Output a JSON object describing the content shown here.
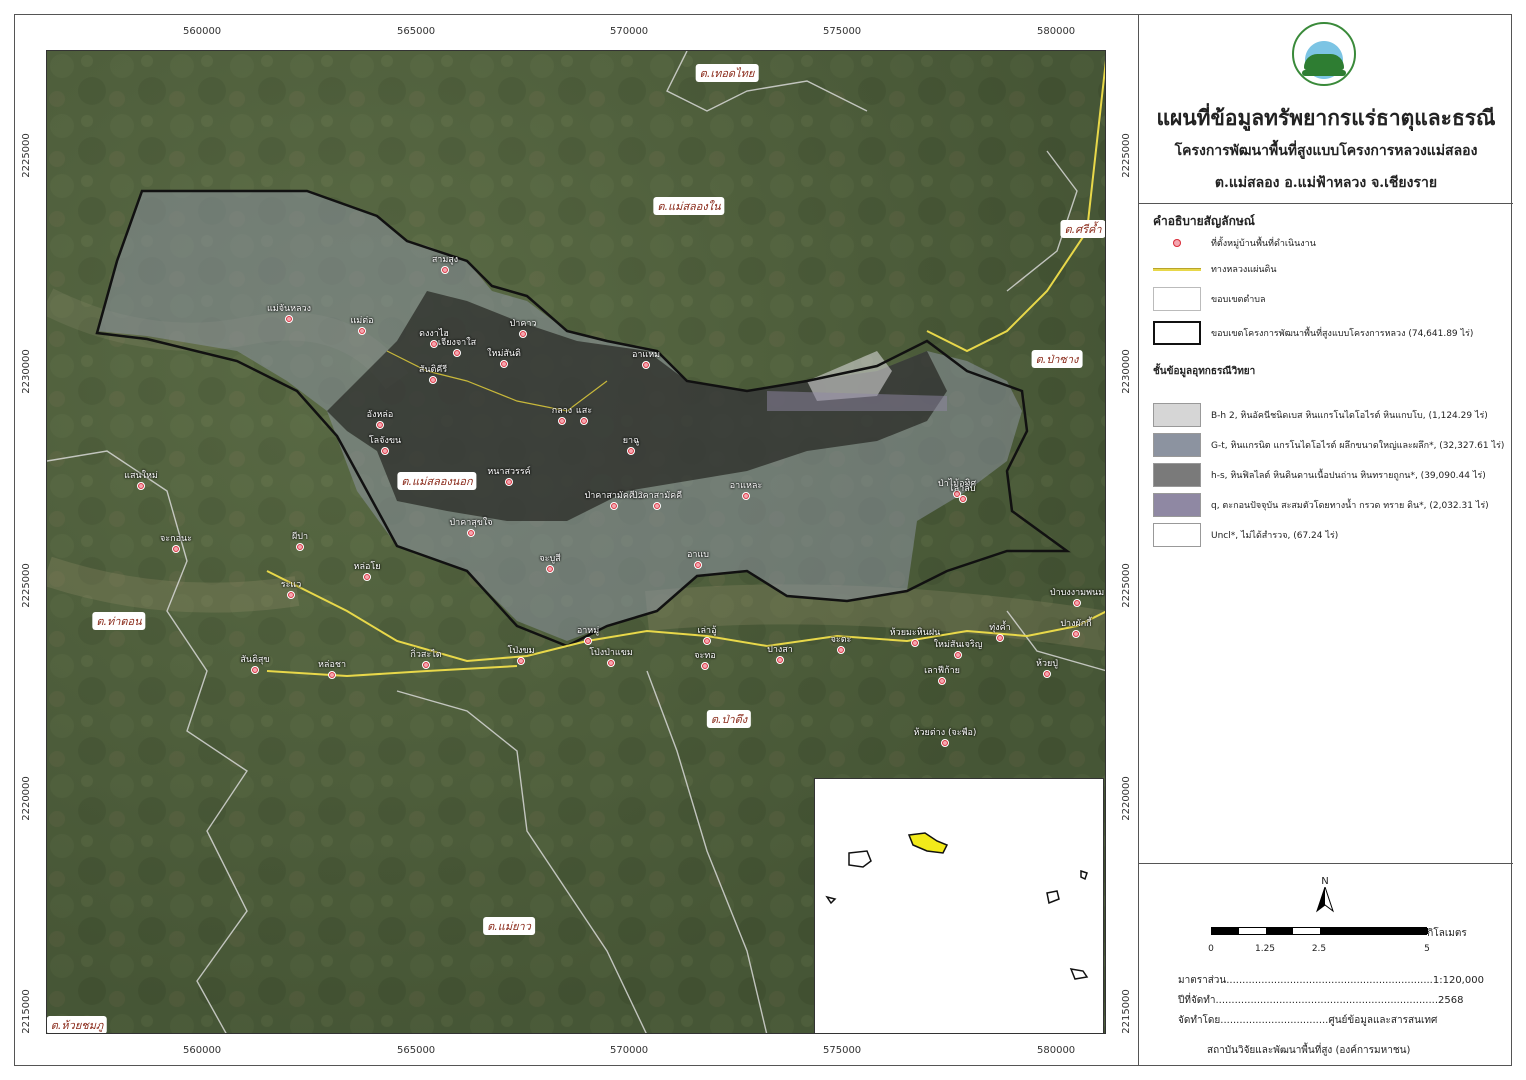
{
  "header": {
    "title": "แผนที่ข้อมูลทรัพยากรแร่ธาตุและธรณี",
    "subtitle": "โครงการพัฒนาพื้นที่สูงแบบโครงการหลวงแม่สลอง",
    "location": "ต.แม่สลอง อ.แม่ฟ้าหลวง จ.เชียงราย"
  },
  "coords": {
    "x_top": [
      "560000",
      "565000",
      "570000",
      "575000",
      "580000"
    ],
    "x_bottom": [
      "560000",
      "565000",
      "570000",
      "575000",
      "580000"
    ],
    "y_left": [
      "2225000",
      "2230000",
      "2225000",
      "2220000",
      "2215000"
    ],
    "y_right": [
      "2225000",
      "2230000",
      "2225000",
      "2220000",
      "2215000"
    ]
  },
  "legend": {
    "heading": "คำอธิบายสัญลักษณ์",
    "villages": "ที่ตั้งหมู่บ้านพื้นที่ดำเนินงาน",
    "highway": "ทางหลวงแผ่นดิน",
    "subdistrict": "ขอบเขตตำบล",
    "project": "ขอบเขตโครงการพัฒนาพื้นที่สูงแบบโครงการหลวง (74,641.89 ไร่)",
    "geo_heading": "ชั้นข้อมูลอุทกธรณีวิทยา",
    "geo": [
      {
        "label": "B-h 2, หินอัคนีชนิดเบส หินแกรโนไดโอไรต์ หินแกบโบ, (1,124.29 ไร่)",
        "color": "#d6d6d6"
      },
      {
        "label": "G-t, หินแกรนิต แกรโนไดโอไรต์ ผลึกขนาดใหญ่และผลึก*, (32,327.61 ไร่)",
        "color": "#8c93a0"
      },
      {
        "label": "h-s, หินฟิลไลต์ หินดินดานเนื้อปนถ่าน หินทรายถูกน*, (39,090.44 ไร่)",
        "color": "#7a7a7a"
      },
      {
        "label": "q, ตะกอนปัจจุบัน สะสมตัวโดยทางน้ำ กรวด ทราย ดิน*, (2,032.31 ไร่)",
        "color": "#8f88a3"
      },
      {
        "label": "Uncl*, ไม่ได้สำรวจ, (67.24 ไร่)",
        "color": "#ffffff"
      }
    ]
  },
  "scale": {
    "north": "N",
    "unit": "กิโลเมตร",
    "ticks": [
      "0",
      "1.25",
      "2.5",
      "5"
    ]
  },
  "info": {
    "scale_label": "มาตราส่วน.................................................................1:120,000",
    "year_label": "ปีที่จัดทำ......................................................................2568",
    "by_label": "จัดทำโดย..................................ศูนย์ข้อมูลและสารสนเทศ",
    "org": "สถาบันวิจัยและพัฒนาพื้นที่สูง (องค์การมหาชน)"
  },
  "tambons": [
    {
      "name": "ต.เทอดไทย"
    },
    {
      "name": "ต.แม่สลองใน"
    },
    {
      "name": "ต.ศรีค้ำ"
    },
    {
      "name": "ต.ป่าซาง"
    },
    {
      "name": "ต.แม่สลองนอก"
    },
    {
      "name": "ต.ท่าตอน"
    },
    {
      "name": "ต.ป่าตึง"
    },
    {
      "name": "ต.แม่ยาว"
    },
    {
      "name": "ต.ห้วยชมภู"
    }
  ],
  "villages": [
    "สามสูง",
    "แม่จันหลวง",
    "แม่ต่อ",
    "ดงงาไฮ",
    "ป่าคาว",
    "เจียงจาใส",
    "ใหม่สันติ",
    "อาแหม",
    "สันติคีรี",
    "อังหล่อ",
    "กลาง",
    "แสะ",
    "โลจังขน",
    "ยาฉู",
    "แสนใหม่",
    "หนาสวรรค์",
    "อาแหละ",
    "ป่าไม้อุทิศ",
    "เลาลิบ",
    "ป่าคาสามัคคี 2",
    "ป่าคาสามัคคี",
    "ป่าคาสุขใจ",
    "จะกอนะ",
    "ผีปา",
    "จะบูสี",
    "อาแบ",
    "หล่อโย",
    "ระแว",
    "ป่าบงงามพนม",
    "ห้วยมะหินฝน",
    "ทุ่งค้ำ",
    "ปางผักกี้",
    "อาหมู่",
    "เล่าอู้",
    "จะตะ",
    "ปางสา",
    "ใหม่สันเจริญ",
    "สันติสุข",
    "กิ่วสะไต",
    "โป่งขม",
    "โป่งป่าแขม",
    "จะทอ",
    "เลาฟีก้าย",
    "ห้วยปู่",
    "หล่อชา",
    "ห้วยต่าง (จะพือ)"
  ]
}
